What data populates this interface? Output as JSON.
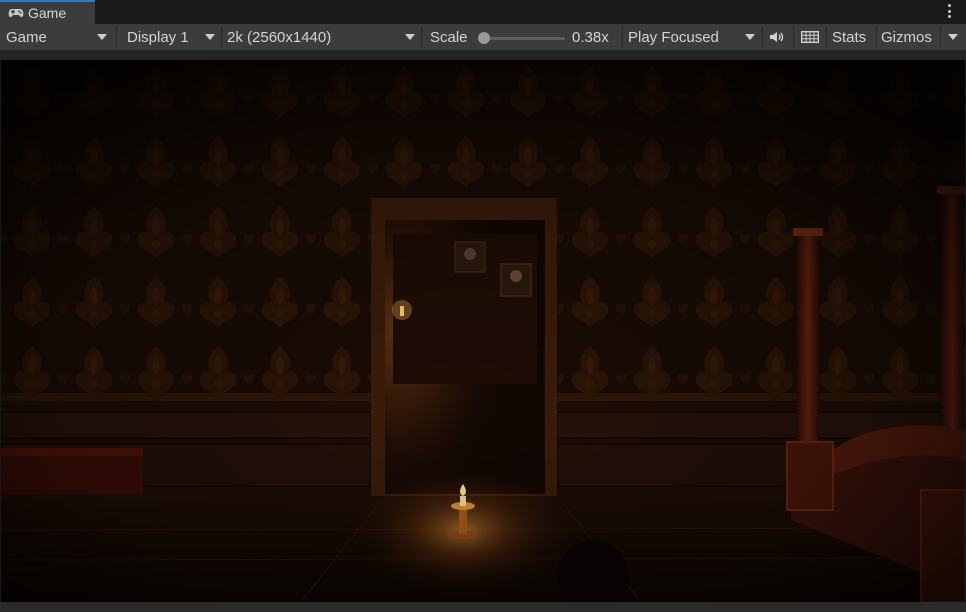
{
  "window": {
    "tab_title": "Game",
    "tab_icon": "gamepad-icon",
    "menu_icon": "kebab-menu-icon"
  },
  "toolbar": {
    "view_mode": "Game",
    "display": "Display 1",
    "resolution": "2k (2560x1440)",
    "scale_label": "Scale",
    "scale_value": "0.38x",
    "play_mode": "Play Focused",
    "audio_icon": "speaker-icon",
    "grid_icon": "grid-keyboard-icon",
    "stats_label": "Stats",
    "gizmos_label": "Gizmos"
  },
  "colors": {
    "toolbar_bg": "#3c3c3c",
    "tab_accent": "#3a79bb",
    "background": "#191919",
    "scene_dark": "#140904",
    "candle_glow": "#ffb347"
  }
}
